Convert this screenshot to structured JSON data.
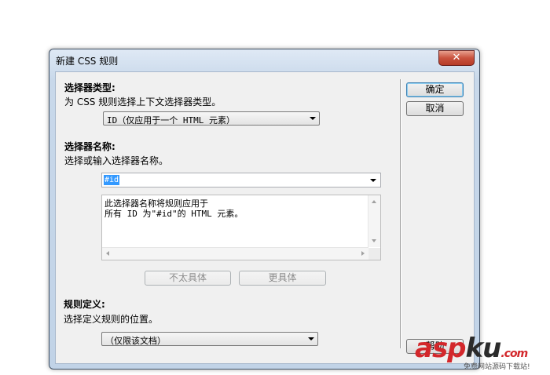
{
  "window": {
    "title": "新建 CSS 规则",
    "close_symbol": "✕"
  },
  "selector_type": {
    "heading": "选择器类型:",
    "description": "为 CSS 规则选择上下文选择器类型。",
    "selected": "ID（仅应用于一个 HTML 元素）"
  },
  "selector_name": {
    "heading": "选择器名称:",
    "description": "选择或输入选择器名称。",
    "value": "#id",
    "preview_lines": [
      "此选择器名称将规则应用于",
      "所有 ID 为\"#id\"的 HTML 元素。"
    ]
  },
  "buttons": {
    "ok": "确定",
    "cancel": "取消",
    "less_specific": "不太具体",
    "more_specific": "更具体",
    "help": "帮助"
  },
  "rule_definition": {
    "heading": "规则定义:",
    "description": "选择定义规则的位置。",
    "selected": "（仅限该文档）"
  },
  "watermark": {
    "brand_red": "asp",
    "brand_dark": "ku",
    "suffix": ".com",
    "tagline": "免费网站源码下载站!"
  }
}
